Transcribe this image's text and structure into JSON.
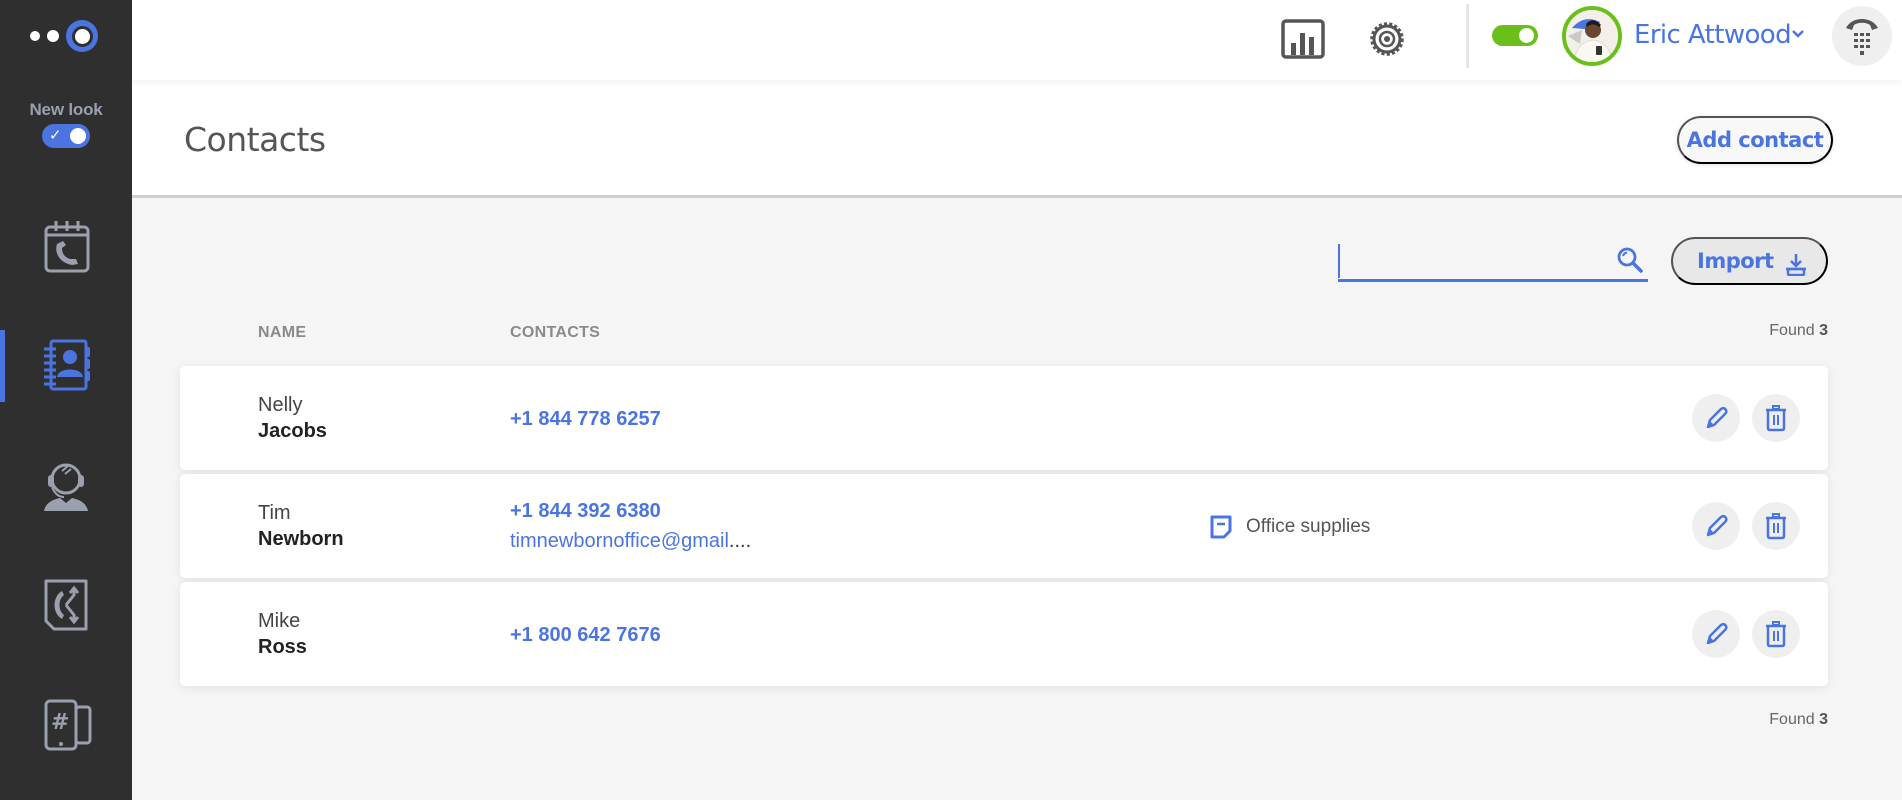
{
  "sidebar": {
    "new_look_label": "New look",
    "new_look_enabled": true,
    "nav": [
      {
        "id": "call-history",
        "icon": "calendar-phone-icon",
        "active": false
      },
      {
        "id": "contacts",
        "icon": "address-book-icon",
        "active": true
      },
      {
        "id": "agents",
        "icon": "headset-agent-icon",
        "active": false
      },
      {
        "id": "call-routing",
        "icon": "call-split-icon",
        "active": false
      },
      {
        "id": "numbers",
        "icon": "hash-phone-icon",
        "active": false
      }
    ]
  },
  "topbar": {
    "icons": [
      "analytics-icon",
      "settings-gear-icon"
    ],
    "status_online": true,
    "user_name": "Eric Attwood",
    "dialer_icon": "dialpad-phone-icon"
  },
  "page": {
    "title": "Contacts",
    "add_contact_label": "Add contact"
  },
  "toolbar": {
    "search_value": "",
    "search_placeholder": "",
    "import_label": "Import"
  },
  "table": {
    "columns": [
      "NAME",
      "CONTACTS"
    ],
    "found_label": "Found",
    "found_count": "3",
    "rows": [
      {
        "first": "Nelly",
        "last": "Jacobs",
        "phone": "+1 844 778 6257",
        "email": null,
        "note": null
      },
      {
        "first": "Tim",
        "last": "Newborn",
        "phone": "+1 844 392 6380",
        "email": "timnewbornoffice@gmail",
        "email_ellipsis": "....",
        "note": "Office supplies"
      },
      {
        "first": "Mike",
        "last": "Ross",
        "phone": "+1 800 642 7676",
        "email": null,
        "note": null
      }
    ]
  },
  "colors": {
    "accent": "#4a74e0",
    "sidebar_bg": "#2f2f2f",
    "online_green": "#6bbf1a",
    "sidebar_icon": "#9aa0ad"
  }
}
